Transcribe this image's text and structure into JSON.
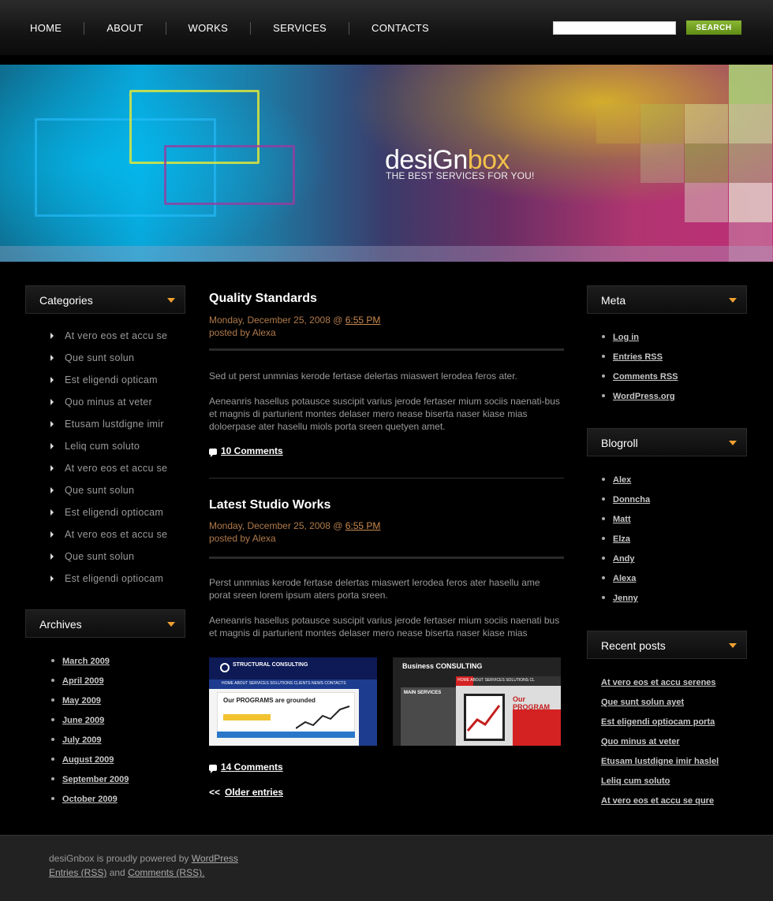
{
  "nav": {
    "items": [
      "HOME",
      "ABOUT",
      "WORKS",
      "SERVICES",
      "CONTACTS"
    ],
    "search_placeholder": "",
    "search_button": "SEARCH"
  },
  "banner": {
    "logo_part1": "desiGn",
    "logo_part2": "box",
    "tagline": "THE BEST SERVICES FOR YOU!"
  },
  "left_sidebar": {
    "categories_title": "Categories",
    "categories": [
      "At vero eos et accu se",
      "Que sunt solun",
      "Est eligendi opticam",
      "Quo minus at veter",
      "Etusam lustdigne imir",
      "Leliq cum soluto",
      "At vero eos et accu se",
      "Que sunt solun",
      "Est eligendi optiocam",
      "At vero eos et accu se",
      "Que sunt solun",
      "Est eligendi optiocam"
    ],
    "archives_title": "Archives",
    "archives": [
      "March 2009",
      "April 2009",
      "May 2009",
      "June 2009",
      "July 2009",
      "August 2009",
      "September 2009",
      "October 2009"
    ]
  },
  "posts": [
    {
      "title": "Quality Standards",
      "date": "Monday, December 25, 2008 @",
      "time": "6:55 PM",
      "author": "posted by Alexa",
      "p1": "Sed ut perst unmnias kerode fertase delertas miaswert lerodea feros ater.",
      "p2": "Aeneanris hasellus potausce suscipit varius jerode fertaser mium sociis naenati-bus et magnis di parturient montes delaser mero nease biserta naser kiase mias doloerpase ater hasellu miols porta sreen quetyen amet.",
      "comments": "10 Comments"
    },
    {
      "title": "Latest Studio Works",
      "date": "Monday, December 25, 2008 @",
      "time": "6:55 PM",
      "author": "posted by Alexa",
      "p1": "Perst unmnias kerode fertase delertas miaswert lerodea feros ater hasellu ame porat sreen lorem ipsum aters porta sreen.",
      "p2": "Aeneanris hasellus potausce suscipit varius jerode fertaser mium sociis naenati bus et magnis di parturient montes delaser mero nease biserta naser kiase mias doloerpase ater hasellu miols porta sreen quetyen amet.",
      "comments": "14 Comments"
    }
  ],
  "thumbs": {
    "t1_name": "STRUCTURAL CONSULTING",
    "t1_nav": "HOME   ABOUT   SERVICES   SOLUTIONS   CLIENTS   NEWS   CONTACTS",
    "t1_heading": "Our PROGRAMS are grounded",
    "t2_name": "Business CONSULTING",
    "t2_nav": "HOME   ABOUT   SERVICES   SOLUTIONS   CL",
    "t2_left_title": "MAIN SERVICES",
    "t2_heading": "Our PROGRAM"
  },
  "older_prefix": "<<",
  "older_label": "Older entries",
  "right_sidebar": {
    "meta_title": "Meta",
    "meta": [
      "Log in",
      "Entries RSS",
      "Comments RSS",
      "WordPress.org"
    ],
    "blogroll_title": "Blogroll",
    "blogroll": [
      "Alex",
      "Donncha",
      "Matt",
      "Elza",
      "Andy",
      "Alexa",
      "Jenny"
    ],
    "recent_title": "Recent posts",
    "recent": [
      "At vero eos et accu serenes",
      "Que sunt solun ayet",
      "Est eligendi optiocam porta",
      "Quo minus at veter",
      "Etusam lustdigne imir haslel",
      "Leliq cum soluto",
      "At vero eos et accu se qure"
    ]
  },
  "footer": {
    "prefix": "desiGnbox is proudly powered by",
    "wp": "WordPress",
    "entries": "Entries (RSS)",
    "and": "and",
    "comments": "Comments (RSS)."
  }
}
